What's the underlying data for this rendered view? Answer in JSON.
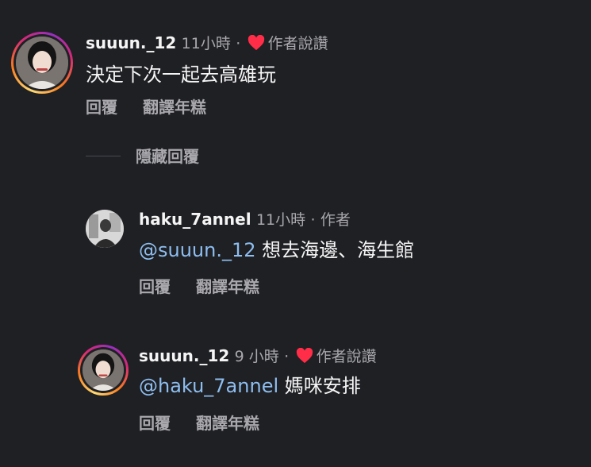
{
  "comments": [
    {
      "username": "suuun._12",
      "time": "11小時",
      "separator": "·",
      "author_liked": "作者說讚",
      "text": "決定下次一起去高雄玩",
      "reply": "回覆",
      "translate": "翻譯年糕"
    },
    {
      "username": "haku_7annel",
      "time": "11小時",
      "separator": "·",
      "author_badge": "作者",
      "mention": "@suuun._12",
      "text": "想去海邊、海生館",
      "reply": "回覆",
      "translate": "翻譯年糕"
    },
    {
      "username": "suuun._12",
      "time": "9 小時",
      "separator": "·",
      "author_liked": "作者說讚",
      "mention": "@haku_7annel",
      "text": "媽咪安排",
      "reply": "回覆",
      "translate": "翻譯年糕"
    }
  ],
  "hide_replies": "隱藏回覆",
  "colors": {
    "background": "#1f2024",
    "mention": "#8ebef0",
    "heart": "#ff2d48",
    "muted": "#a8a8ad"
  },
  "icons": {
    "heart": "heart-icon"
  }
}
